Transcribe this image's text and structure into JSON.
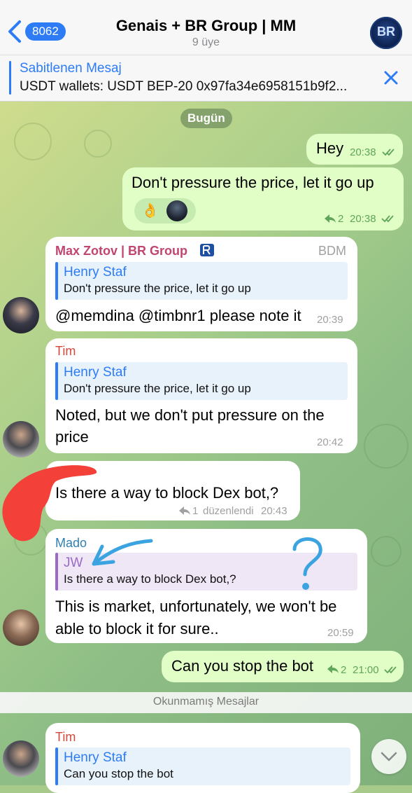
{
  "header": {
    "back_count": "8062",
    "title": "Genais + BR Group | MM",
    "subtitle": "9 üye",
    "avatar_glyph": "BR"
  },
  "pinned": {
    "title": "Sabitlenen Mesaj",
    "text": "USDT wallets: USDT BEP-20 0x97fa34e6958151b9f2..."
  },
  "chat": {
    "date_label": "Bugün",
    "unread_label": "Okunmamış Mesajlar",
    "messages": [
      {
        "text": "Hey",
        "time": "20:38"
      },
      {
        "text": "Don't pressure the price, let it go up",
        "time": "20:38",
        "reply_count": "2",
        "reactions": [
          "👌",
          "avatar"
        ]
      },
      {
        "sender": "Max Zotov | BR Group",
        "badge": "BDM",
        "reply_name": "Henry Staf",
        "reply_text": "Don't pressure the price, let it go up",
        "text": "@memdina @timbnr1 please note it",
        "time": "20:39"
      },
      {
        "sender": "Tim",
        "reply_name": "Henry Staf",
        "reply_text": "Don't pressure the price, let it go up",
        "text_line1": "Noted, but we don't put pressure on the",
        "text_line2": "price",
        "time": "20:42"
      },
      {
        "text": "Is there a way to block Dex bot,?",
        "reply_count": "1",
        "edited_label": "düzenlendi",
        "time": "20:43"
      },
      {
        "sender": "Mado",
        "reply_name": "JW",
        "reply_text": "Is there a way to block Dex bot,?",
        "text_line1": "This is market, unfortunately, we won't be",
        "text_line2": "able to block it for sure..",
        "time": "20:59"
      },
      {
        "text": "Can you stop the bot",
        "reply_count": "2",
        "time": "21:00"
      },
      {
        "sender": "Tim",
        "reply_name": "Henry Staf",
        "reply_text": "Can you stop the bot"
      }
    ]
  },
  "colors": {
    "accent": "#2d7cf6",
    "outgoing_bubble": "#e1fec6",
    "incoming_bubble": "#ffffff",
    "sender_max": "#c2456f",
    "sender_tim": "#d4493a",
    "sender_mado": "#2f7fb5",
    "annotation_red": "#f3413a",
    "annotation_blue": "#3aa3e0"
  },
  "icons": [
    "back-chevron-icon",
    "close-icon",
    "double-check-icon",
    "reply-arrow-icon",
    "scroll-down-icon",
    "brand-logo-icon"
  ]
}
